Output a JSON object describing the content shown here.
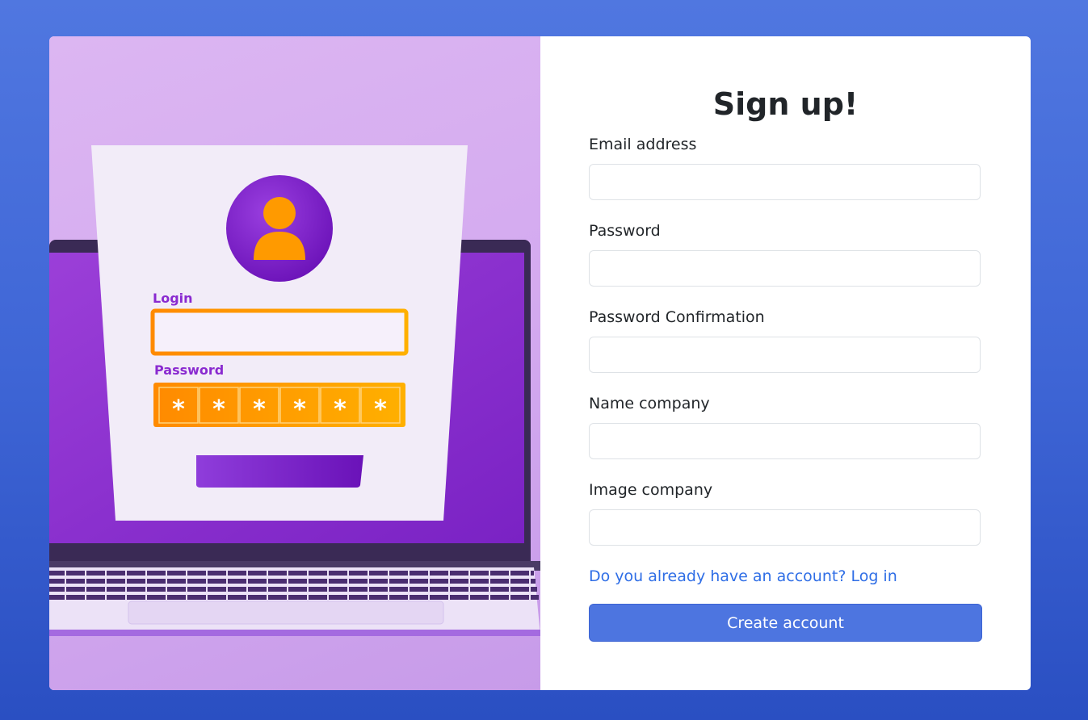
{
  "form": {
    "title": "Sign up!",
    "fields": [
      {
        "label": "Email address",
        "value": "",
        "placeholder": ""
      },
      {
        "label": "Password",
        "value": "",
        "placeholder": ""
      },
      {
        "label": "Password Confirmation",
        "value": "",
        "placeholder": ""
      },
      {
        "label": "Name company",
        "value": "",
        "placeholder": ""
      },
      {
        "label": "Image company",
        "value": "",
        "placeholder": ""
      }
    ],
    "login_link": "Do you already have an account? Log in",
    "submit_label": "Create account"
  },
  "illustration": {
    "login_label": "Login",
    "password_label": "Password",
    "mask_char": "*"
  },
  "colors": {
    "page_bg": "#4a72dd",
    "accent": "#4d75e0",
    "link": "#2f6ee6",
    "illustration_bg": "#d8b3f2",
    "illustration_purple": "#7b22c9",
    "illustration_orange": "#ff9a00"
  }
}
